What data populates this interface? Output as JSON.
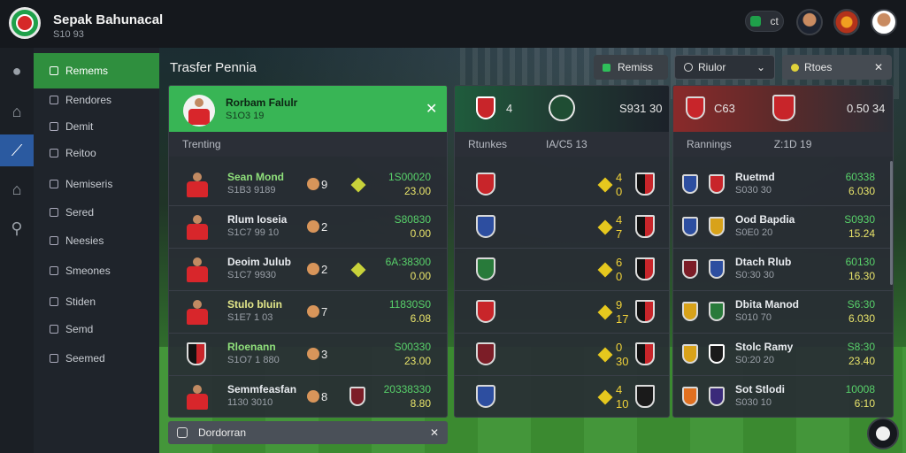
{
  "app": {
    "title": "Sepak Bahunacal",
    "subtitle": "S10 93"
  },
  "topbar": {
    "pill_text": "ct"
  },
  "rail": [
    "ball-icon",
    "home-icon",
    "stats-icon",
    "bank-icon",
    "search-icon"
  ],
  "sidebar": {
    "items": [
      {
        "label": "Remems"
      },
      {
        "label": "Rendores"
      },
      {
        "label": "Demit"
      },
      {
        "label": "Reitoo"
      },
      {
        "label": "Nemiseris"
      },
      {
        "label": "Sered"
      },
      {
        "label": "Neesies"
      },
      {
        "label": "Smeones"
      },
      {
        "label": "Stiden"
      },
      {
        "label": "Semd"
      },
      {
        "label": "Seemed"
      }
    ]
  },
  "main": {
    "title": "Trasfer Pennia",
    "transfers_button": "Remiss",
    "filter_label": "Riulor",
    "search_label": "Rtoes"
  },
  "panel1": {
    "player_name": "Rorbam Falulr",
    "player_meta": "S1O3 19",
    "sub_label": "Trenting",
    "rows": [
      {
        "name": "Sean Mond",
        "meta": "S1B3 9189",
        "rank": "9",
        "v1": "1S00020",
        "v2": "23.00"
      },
      {
        "name": "Rlum Ioseia",
        "meta": "S1C7 99 10",
        "rank": "2",
        "v1": "S80830",
        "v2": "0.00"
      },
      {
        "name": "Deoim Julub",
        "meta": "S1C7 9930",
        "rank": "2",
        "v1": "6A:38300",
        "v2": "0.00"
      },
      {
        "name": "Stulo bluin",
        "meta": "S1E7 1 03",
        "rank": "7",
        "v1": "11830S0",
        "v2": "6.08"
      },
      {
        "name": "Rloenann",
        "meta": "S1O7 1 880",
        "rank": "3",
        "v1": "S00330",
        "v2": "23.00"
      },
      {
        "name": "Semmfeasfan",
        "meta": "1130 3010",
        "rank": "8",
        "v1": "20338330",
        "v2": "8.80"
      }
    ]
  },
  "panel2": {
    "header_value": "S931 30",
    "header_mid": "4",
    "sub_label": "Rtunkes",
    "sub_value": "IA/C5 13",
    "rows": [
      {
        "a": "4",
        "b": "0"
      },
      {
        "a": "4",
        "b": "7"
      },
      {
        "a": "6",
        "b": "0"
      },
      {
        "a": "9",
        "b": "17"
      },
      {
        "a": "0",
        "b": "30"
      },
      {
        "a": "4",
        "b": "10"
      }
    ]
  },
  "panel3": {
    "header_left": "C63",
    "header_value": "0.50 34",
    "sub_label": "Rannings",
    "sub_value": "Z:1D 19",
    "rows": [
      {
        "name": "Ruetmd",
        "meta": "S030 30",
        "v1": "60338",
        "v2": "6.030"
      },
      {
        "name": "Ood Bapdia",
        "meta": "S0E0 20",
        "v1": "S0930",
        "v2": "15.24"
      },
      {
        "name": "Dtach Rlub",
        "meta": "S0:30 30",
        "v1": "60130",
        "v2": "16.30"
      },
      {
        "name": "Dbita Manod",
        "meta": "S010 70",
        "v1": "S6:30",
        "v2": "6.030"
      },
      {
        "name": "Stolc Ramy",
        "meta": "S0:20 20",
        "v1": "S8:30",
        "v2": "23.40"
      },
      {
        "name": "Sot Stlodi",
        "meta": "S030 10",
        "v1": "10008",
        "v2": "6:10"
      }
    ]
  },
  "bottom_bar": {
    "label": "Dordorran"
  },
  "colors": {
    "accent": "#38b555",
    "rail_active": "#2b5aa0",
    "red_panel": "#8a2a2a"
  }
}
